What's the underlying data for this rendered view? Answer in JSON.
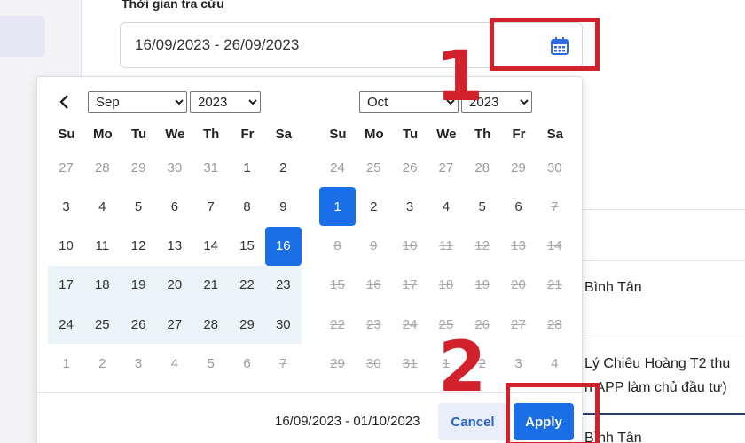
{
  "filter": {
    "label": "Thời gian tra cứu",
    "value": "16/09/2023 - 26/09/2023",
    "icon": "calendar-icon"
  },
  "right_rows": {
    "row1": "Bình Tân",
    "row2_line1": "Lý Chiêu Hoàng T2 thu",
    "row2_line2": "n APP làm chủ đầu tư)",
    "row3": "Bình Tân"
  },
  "annotations": {
    "marker1": "1",
    "marker2": "2",
    "color": "#d1222b"
  },
  "picker": {
    "weekdays": [
      "Su",
      "Mo",
      "Tu",
      "We",
      "Th",
      "Fr",
      "Sa"
    ],
    "left": {
      "month": "Sep",
      "year": "2023",
      "weeks": [
        [
          {
            "d": "27",
            "s": "off"
          },
          {
            "d": "28",
            "s": "off"
          },
          {
            "d": "29",
            "s": "off"
          },
          {
            "d": "30",
            "s": "off"
          },
          {
            "d": "31",
            "s": "off"
          },
          {
            "d": "1",
            "s": ""
          },
          {
            "d": "2",
            "s": ""
          }
        ],
        [
          {
            "d": "3",
            "s": ""
          },
          {
            "d": "4",
            "s": ""
          },
          {
            "d": "5",
            "s": ""
          },
          {
            "d": "6",
            "s": ""
          },
          {
            "d": "7",
            "s": ""
          },
          {
            "d": "8",
            "s": ""
          },
          {
            "d": "9",
            "s": ""
          }
        ],
        [
          {
            "d": "10",
            "s": ""
          },
          {
            "d": "11",
            "s": ""
          },
          {
            "d": "12",
            "s": ""
          },
          {
            "d": "13",
            "s": ""
          },
          {
            "d": "14",
            "s": ""
          },
          {
            "d": "15",
            "s": ""
          },
          {
            "d": "16",
            "s": "active"
          }
        ],
        [
          {
            "d": "17",
            "s": "inrange"
          },
          {
            "d": "18",
            "s": "inrange"
          },
          {
            "d": "19",
            "s": "inrange"
          },
          {
            "d": "20",
            "s": "inrange"
          },
          {
            "d": "21",
            "s": "inrange"
          },
          {
            "d": "22",
            "s": "inrange"
          },
          {
            "d": "23",
            "s": "inrange"
          }
        ],
        [
          {
            "d": "24",
            "s": "inrange"
          },
          {
            "d": "25",
            "s": "inrange"
          },
          {
            "d": "26",
            "s": "inrange"
          },
          {
            "d": "27",
            "s": "inrange"
          },
          {
            "d": "28",
            "s": "inrange"
          },
          {
            "d": "29",
            "s": "inrange"
          },
          {
            "d": "30",
            "s": "inrange"
          }
        ],
        [
          {
            "d": "1",
            "s": "off"
          },
          {
            "d": "2",
            "s": "off"
          },
          {
            "d": "3",
            "s": "off"
          },
          {
            "d": "4",
            "s": "off"
          },
          {
            "d": "5",
            "s": "off"
          },
          {
            "d": "6",
            "s": "off"
          },
          {
            "d": "7",
            "s": "off dis"
          }
        ]
      ]
    },
    "right": {
      "month": "Oct",
      "year": "2023",
      "weeks": [
        [
          {
            "d": "24",
            "s": "off"
          },
          {
            "d": "25",
            "s": "off"
          },
          {
            "d": "26",
            "s": "off"
          },
          {
            "d": "27",
            "s": "off"
          },
          {
            "d": "28",
            "s": "off"
          },
          {
            "d": "29",
            "s": "off"
          },
          {
            "d": "30",
            "s": "off"
          }
        ],
        [
          {
            "d": "1",
            "s": "active"
          },
          {
            "d": "2",
            "s": ""
          },
          {
            "d": "3",
            "s": ""
          },
          {
            "d": "4",
            "s": ""
          },
          {
            "d": "5",
            "s": ""
          },
          {
            "d": "6",
            "s": ""
          },
          {
            "d": "7",
            "s": "dis"
          }
        ],
        [
          {
            "d": "8",
            "s": "dis"
          },
          {
            "d": "9",
            "s": "dis"
          },
          {
            "d": "10",
            "s": "dis"
          },
          {
            "d": "11",
            "s": "dis"
          },
          {
            "d": "12",
            "s": "dis"
          },
          {
            "d": "13",
            "s": "dis"
          },
          {
            "d": "14",
            "s": "dis"
          }
        ],
        [
          {
            "d": "15",
            "s": "dis"
          },
          {
            "d": "16",
            "s": "dis"
          },
          {
            "d": "17",
            "s": "dis"
          },
          {
            "d": "18",
            "s": "dis"
          },
          {
            "d": "19",
            "s": "dis"
          },
          {
            "d": "20",
            "s": "dis"
          },
          {
            "d": "21",
            "s": "dis"
          }
        ],
        [
          {
            "d": "22",
            "s": "dis"
          },
          {
            "d": "23",
            "s": "dis"
          },
          {
            "d": "24",
            "s": "dis"
          },
          {
            "d": "25",
            "s": "dis"
          },
          {
            "d": "26",
            "s": "dis"
          },
          {
            "d": "27",
            "s": "dis"
          },
          {
            "d": "28",
            "s": "dis"
          }
        ],
        [
          {
            "d": "29",
            "s": "off dis"
          },
          {
            "d": "30",
            "s": "off dis"
          },
          {
            "d": "31",
            "s": "off dis"
          },
          {
            "d": "1",
            "s": "off dis"
          },
          {
            "d": "2",
            "s": "off dis"
          },
          {
            "d": "3",
            "s": "off"
          },
          {
            "d": "4",
            "s": "off"
          }
        ]
      ]
    },
    "footer_range": "16/09/2023 - 01/10/2023",
    "cancel_label": "Cancel",
    "apply_label": "Apply",
    "accent_color": "#1a6ee6"
  }
}
